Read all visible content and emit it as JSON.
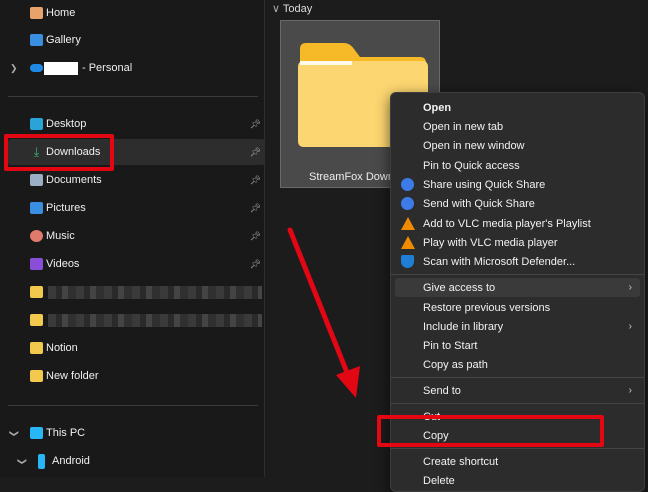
{
  "sidebar": {
    "items": [
      {
        "label": "Home",
        "icon": "home-icon"
      },
      {
        "label": "Gallery",
        "icon": "gallery-icon"
      },
      {
        "label": "- Personal",
        "icon": "onedrive-icon"
      },
      {
        "label": "Desktop",
        "icon": "desktop-icon"
      },
      {
        "label": "Downloads",
        "icon": "download-icon"
      },
      {
        "label": "Documents",
        "icon": "documents-icon"
      },
      {
        "label": "Pictures",
        "icon": "pictures-icon"
      },
      {
        "label": "Music",
        "icon": "music-icon"
      },
      {
        "label": "Videos",
        "icon": "videos-icon"
      },
      {
        "label": "Notion",
        "icon": "folder-icon"
      },
      {
        "label": "New folder",
        "icon": "folder-icon"
      },
      {
        "label": "This PC",
        "icon": "pc-icon"
      },
      {
        "label": "Android",
        "icon": "phone-icon"
      }
    ]
  },
  "main": {
    "group_header": "Today",
    "folder_name": "StreamFox Downlo"
  },
  "context_menu": {
    "items": [
      "Open",
      "Open in new tab",
      "Open in new window",
      "Pin to Quick access",
      "Share using Quick Share",
      "Send with Quick Share",
      "Add to VLC media player's Playlist",
      "Play with VLC media player",
      "Scan with Microsoft Defender...",
      "Give access to",
      "Restore previous versions",
      "Include in library",
      "Pin to Start",
      "Copy as path",
      "Send to",
      "Cut",
      "Copy",
      "Create shortcut",
      "Delete"
    ]
  },
  "colors": {
    "highlight": "#e30613",
    "accent": "#2f7de1"
  }
}
